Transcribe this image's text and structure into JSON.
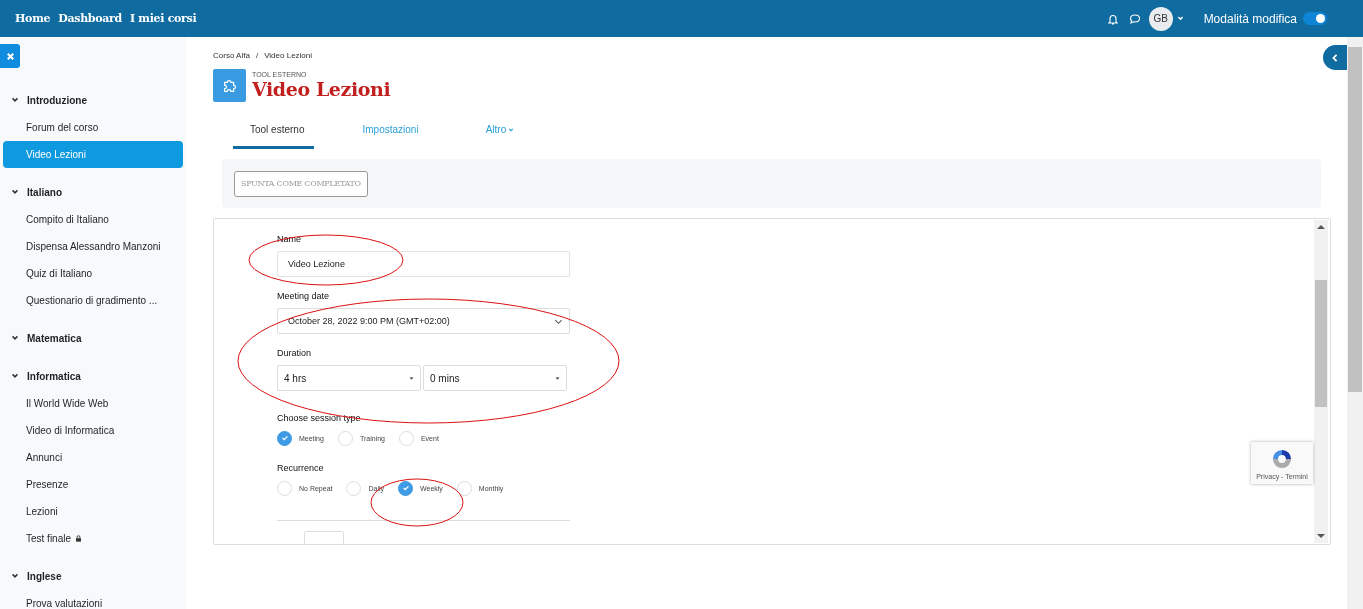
{
  "navbar": {
    "links": [
      "Home",
      "Dashboard",
      "I miei corsi"
    ],
    "avatar_initials": "GB",
    "edit_mode": {
      "label": "Modalità modifica",
      "on": true
    }
  },
  "sidebar": {
    "sections": [
      {
        "title": "Introduzione",
        "expanded": true,
        "children": [
          {
            "label": "Forum del corso",
            "selected": false,
            "locked": false
          },
          {
            "label": "Video Lezioni",
            "selected": true,
            "locked": false
          }
        ]
      },
      {
        "title": "Italiano",
        "expanded": true,
        "children": [
          {
            "label": "Compito di Italiano",
            "selected": false,
            "locked": false
          },
          {
            "label": "Dispensa Alessandro Manzoni",
            "selected": false,
            "locked": false
          },
          {
            "label": "Quiz di Italiano",
            "selected": false,
            "locked": false
          },
          {
            "label": "Questionario di gradimento ...",
            "selected": false,
            "locked": false
          }
        ]
      },
      {
        "title": "Matematica",
        "expanded": true
      },
      {
        "title": "Informatica",
        "expanded": true,
        "children": [
          {
            "label": "Il World Wide Web",
            "selected": false,
            "locked": false
          },
          {
            "label": "Video di Informatica",
            "selected": false,
            "locked": false
          },
          {
            "label": "Annunci",
            "selected": false,
            "locked": false
          },
          {
            "label": "Presenze",
            "selected": false,
            "locked": false
          },
          {
            "label": "Lezioni",
            "selected": false,
            "locked": false
          },
          {
            "label": "Test finale",
            "selected": false,
            "locked": true
          }
        ]
      },
      {
        "title": "Inglese",
        "expanded": true,
        "children": [
          {
            "label": "Prova valutazioni",
            "selected": false,
            "locked": false
          }
        ]
      }
    ]
  },
  "breadcrumb": {
    "items": [
      "Corso Alfa",
      "Video Lezioni"
    ],
    "separator": "/"
  },
  "page_header": {
    "kicker": "TOOL ESTERNO",
    "title": "Video Lezioni"
  },
  "tabs": [
    {
      "label": "Tool esterno",
      "selected": true,
      "dropdown": false
    },
    {
      "label": "Impostazioni",
      "selected": false,
      "dropdown": false
    },
    {
      "label": "Altro",
      "selected": false,
      "dropdown": true
    }
  ],
  "completion_button": "SPUNTA COME COMPLETATO",
  "form": {
    "name": {
      "label": "Name",
      "value": "Video Lezione"
    },
    "meeting_date": {
      "label": "Meeting date",
      "value": "October 28, 2022 9:00 PM (GMT+02:00)"
    },
    "duration": {
      "label": "Duration",
      "hours": "4 hrs",
      "minutes": "0 mins"
    },
    "session_type": {
      "label": "Choose session type",
      "options": [
        {
          "label": "Meeting",
          "selected": true
        },
        {
          "label": "Training",
          "selected": false
        },
        {
          "label": "Event",
          "selected": false
        }
      ]
    },
    "recurrence": {
      "label": "Recurrence",
      "options": [
        {
          "label": "No Repeat",
          "selected": false
        },
        {
          "label": "Daily",
          "selected": false
        },
        {
          "label": "Weekly",
          "selected": true
        },
        {
          "label": "Monthly",
          "selected": false
        }
      ]
    }
  },
  "recaptcha": {
    "text": "Privacy - Termini"
  }
}
